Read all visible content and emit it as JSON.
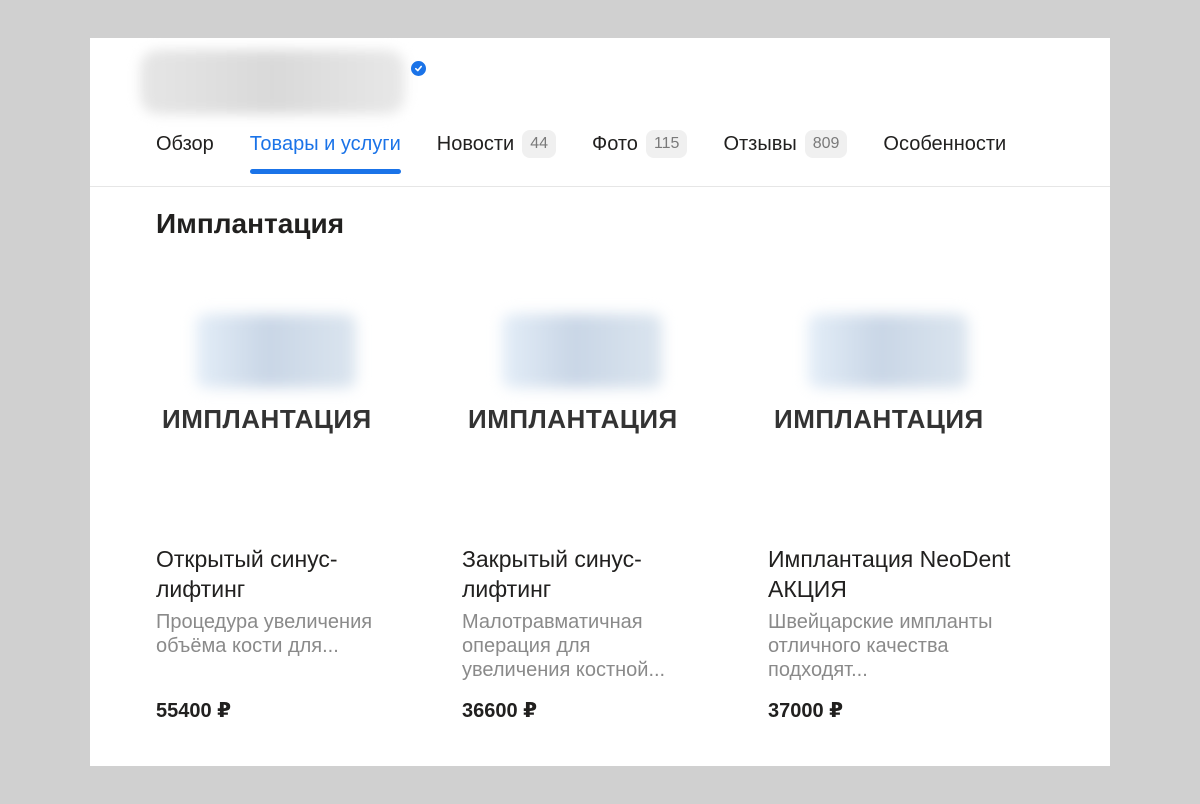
{
  "header": {
    "tabs": [
      {
        "label": "Обзор",
        "count": ""
      },
      {
        "label": "Товары и услуги",
        "count": ""
      },
      {
        "label": "Новости",
        "count": "44"
      },
      {
        "label": "Фото",
        "count": "115"
      },
      {
        "label": "Отзывы",
        "count": "809"
      },
      {
        "label": "Особенности",
        "count": ""
      }
    ],
    "active_tab": "Товары и услуги",
    "accent_color": "#1a73e8"
  },
  "section": {
    "title": "Имплантация"
  },
  "products": [
    {
      "image_label": "ИМПЛАНТАЦИЯ",
      "title": "Открытый синус-лифтинг",
      "description": "Процедура увеличения объёма кости для...",
      "price": "55400 ₽"
    },
    {
      "image_label": "ИМПЛАНТАЦИЯ",
      "title": "Закрытый синус-лифтинг",
      "description": "Малотравматичная операция для увеличения костной...",
      "price": "36600 ₽"
    },
    {
      "image_label": "ИМПЛАНТАЦИЯ",
      "title": "Имплантация NeoDent АКЦИЯ",
      "description": "Швейцарские импланты отличного качества подходят...",
      "price": "37000 ₽"
    }
  ]
}
